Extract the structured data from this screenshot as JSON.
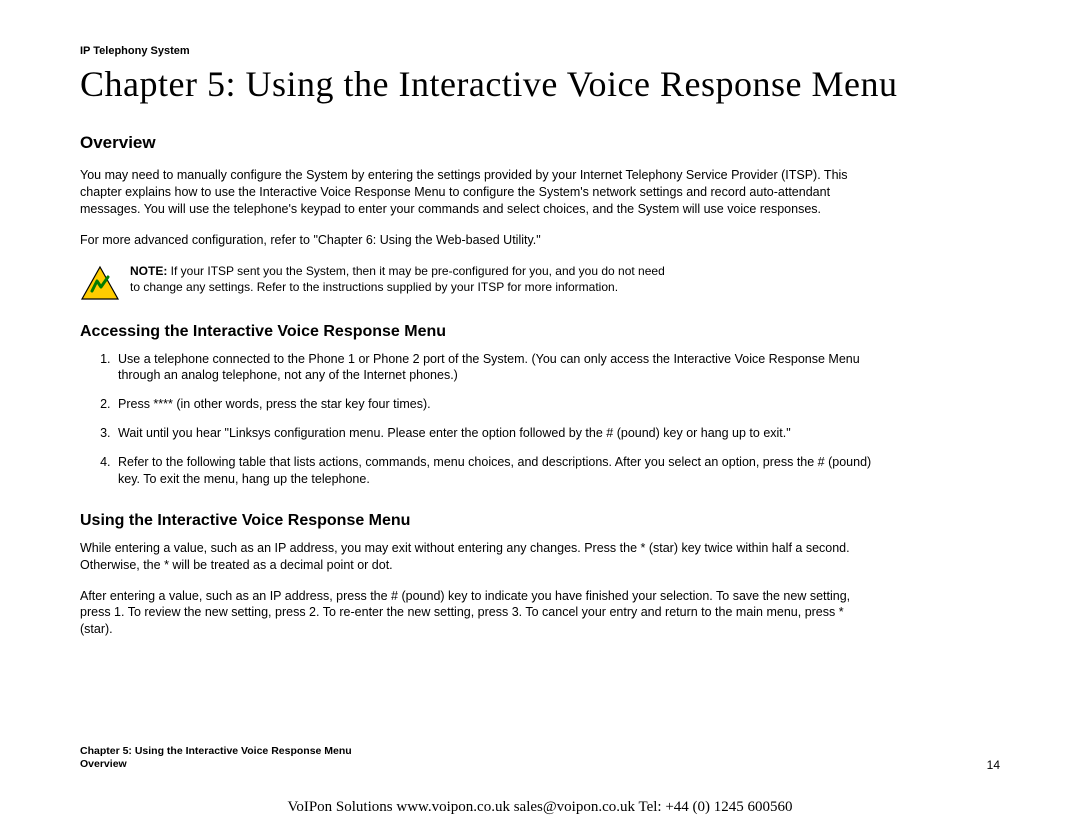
{
  "header_label": "IP Telephony System",
  "chapter_title": "Chapter 5: Using the Interactive Voice Response Menu",
  "overview_heading": "Overview",
  "overview_p1": "You may need to manually configure the System by entering the settings provided by your Internet Telephony Service Provider (ITSP). This chapter explains how to use the Interactive Voice Response Menu to configure the System's network settings and record auto-attendant messages. You will use the telephone's keypad to enter your commands and select choices, and the System will use voice responses.",
  "overview_p2": "For more advanced configuration, refer to \"Chapter 6: Using the Web-based Utility.\"",
  "note_label": "NOTE:",
  "note_text": " If your ITSP sent you the System, then it may be pre-configured for you, and you do not need to change any settings. Refer to the instructions supplied by your ITSP for more information.",
  "accessing_heading": "Accessing the Interactive Voice Response Menu",
  "steps": [
    "Use a telephone connected to the Phone 1 or Phone 2 port of the System. (You can only access the Interactive Voice Response Menu through an analog telephone, not any of the Internet phones.)",
    "Press **** (in other words, press the star key four times).",
    "Wait until you hear \"Linksys configuration menu. Please enter the option followed by the # (pound) key or hang up to exit.\"",
    "Refer to the following table that lists actions, commands, menu choices, and descriptions. After you select an option, press the # (pound) key. To exit the menu, hang up the telephone."
  ],
  "using_heading": "Using the Interactive Voice Response Menu",
  "using_p1": "While entering a value, such as an IP address, you may exit without entering any changes. Press the * (star) key twice within half a second. Otherwise, the * will be treated as a decimal point or dot.",
  "using_p2": "After entering a value, such as an IP address, press the # (pound) key to indicate you have finished your selection. To save the new setting, press 1. To review the new setting, press 2. To re-enter the new setting, press 3. To cancel your entry and return to the main menu, press * (star).",
  "footer_line1": "Chapter 5: Using the Interactive Voice Response Menu",
  "footer_line2": "Overview",
  "footer_page": "14",
  "bottom_contact": "VoIPon Solutions  www.voipon.co.uk  sales@voipon.co.uk  Tel: +44 (0) 1245 600560"
}
